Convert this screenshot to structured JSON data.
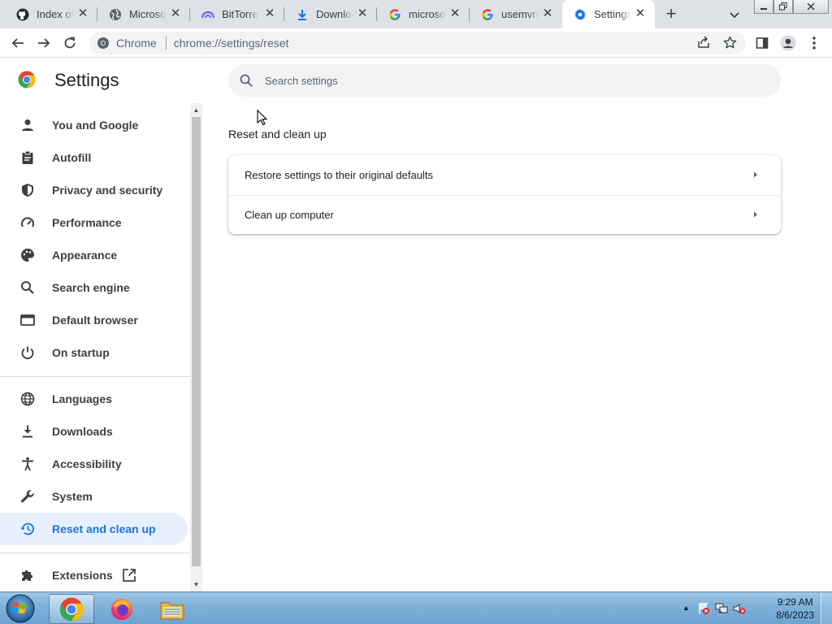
{
  "tabs": [
    {
      "title": "Index of",
      "icon": "github-icon"
    },
    {
      "title": "Microsoft",
      "icon": "globe-icon"
    },
    {
      "title": "BitTorrent",
      "icon": "bittorrent-icon"
    },
    {
      "title": "Download",
      "icon": "download-icon"
    },
    {
      "title": "microsoft",
      "icon": "google-icon"
    },
    {
      "title": "usemvn",
      "icon": "google-icon"
    },
    {
      "title": "Settings",
      "icon": "gear-icon",
      "active": true
    }
  ],
  "omnibox": {
    "chip_label": "Chrome",
    "url": "chrome://settings/reset"
  },
  "header": {
    "title": "Settings",
    "search_placeholder": "Search settings"
  },
  "sidebar": {
    "items": [
      {
        "label": "You and Google",
        "icon": "person-icon"
      },
      {
        "label": "Autofill",
        "icon": "clipboard-icon"
      },
      {
        "label": "Privacy and security",
        "icon": "shield-icon"
      },
      {
        "label": "Performance",
        "icon": "speedometer-icon"
      },
      {
        "label": "Appearance",
        "icon": "palette-icon"
      },
      {
        "label": "Search engine",
        "icon": "search-icon"
      },
      {
        "label": "Default browser",
        "icon": "browser-window-icon"
      },
      {
        "label": "On startup",
        "icon": "power-icon"
      },
      {
        "label": "Languages",
        "icon": "globe-icon"
      },
      {
        "label": "Downloads",
        "icon": "download-icon"
      },
      {
        "label": "Accessibility",
        "icon": "accessibility-icon"
      },
      {
        "label": "System",
        "icon": "wrench-icon"
      },
      {
        "label": "Reset and clean up",
        "icon": "history-icon",
        "active": true
      }
    ],
    "extensions": {
      "label": "Extensions",
      "icon": "puzzle-icon"
    }
  },
  "main": {
    "section_title": "Reset and clean up",
    "rows": [
      {
        "label": "Restore settings to their original defaults"
      },
      {
        "label": "Clean up computer"
      }
    ]
  },
  "taskbar": {
    "apps": [
      "chrome-icon",
      "firefox-icon",
      "file-explorer-icon"
    ],
    "time": "9:29 AM",
    "date": "8/6/2023"
  },
  "colors": {
    "accent": "#1a73e8",
    "active_nav_bg": "#e8f0fe",
    "tabstrip_bg": "#dee1e6"
  }
}
